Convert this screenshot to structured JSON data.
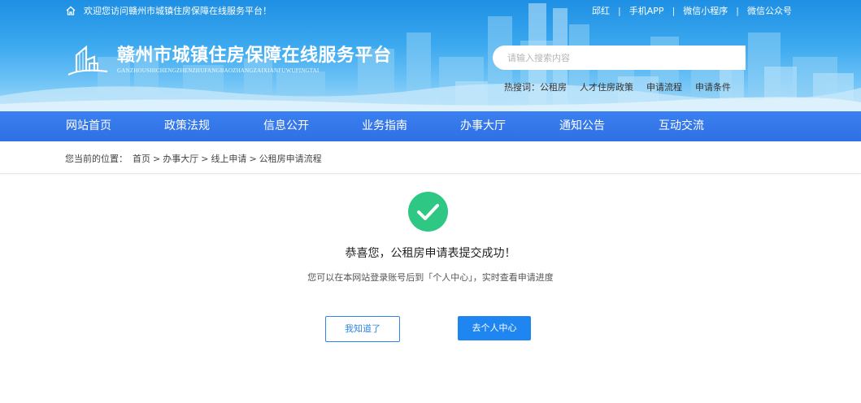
{
  "topbar": {
    "welcome": "欢迎您访问赣州市城镇住房保障在线服务平台！",
    "links": [
      "邱红",
      "手机APP",
      "微信小程序",
      "微信公众号"
    ]
  },
  "logo": {
    "title": "赣州市城镇住房保障在线服务平台",
    "subtitle": "GANZHOUSHICHENGZHENZHUFANGBAOZHANGZAIXIANFUWUPINGTAI"
  },
  "search": {
    "placeholder": "请输入搜索内容",
    "value": ""
  },
  "hotwords": {
    "label": "热搜词：",
    "items": [
      "公租房",
      "人才住房政策",
      "申请流程",
      "申请条件"
    ]
  },
  "nav": {
    "items": [
      "网站首页",
      "政策法规",
      "信息公开",
      "业务指南",
      "办事大厅",
      "通知公告",
      "互动交流"
    ]
  },
  "breadcrumb": {
    "prefix": "您当前的位置：",
    "items": [
      "首页",
      "办事大厅",
      "线上申请",
      "公租房申请流程"
    ],
    "separator": ">"
  },
  "result": {
    "title": "恭喜您，公租房申请表提交成功！",
    "description": "您可以在本网站登录账号后到「个人中心」，实时查看申请进度",
    "icon": "check-circle-icon"
  },
  "buttons": {
    "acknowledge": "我知道了",
    "go_center": "去个人中心"
  },
  "colors": {
    "nav_bg": "#2f70e4",
    "success_green": "#2ec783",
    "primary_blue": "#1f86f1"
  }
}
